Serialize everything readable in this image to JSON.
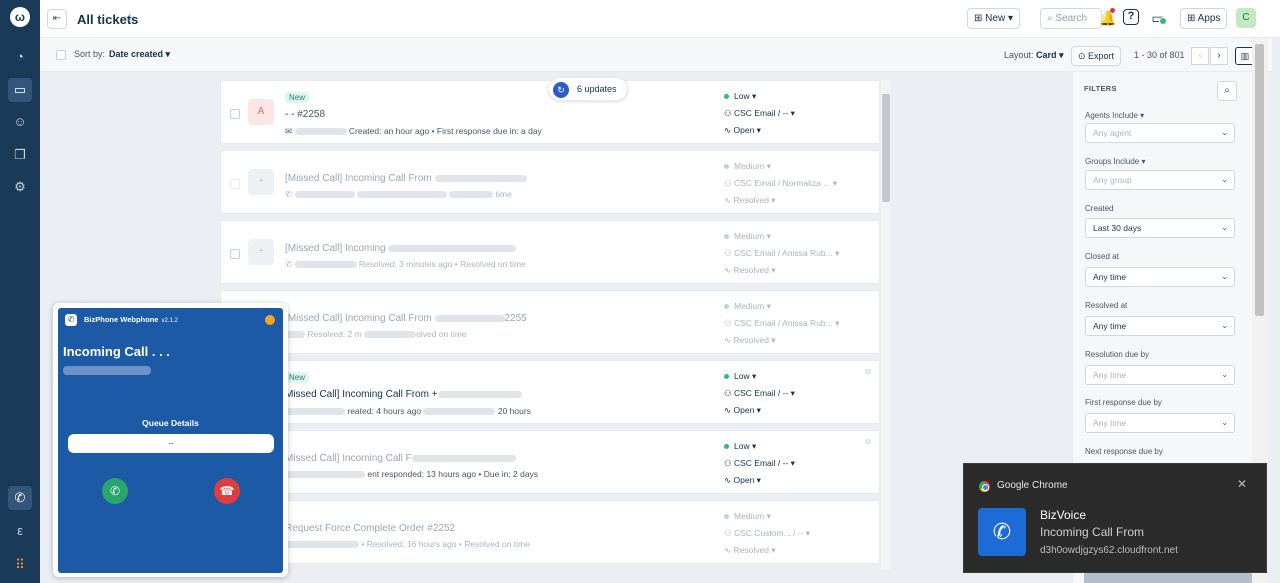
{
  "leftnav": {
    "logo": "ω",
    "items": [
      {
        "name": "dashboard-icon",
        "glyph": "◔"
      },
      {
        "name": "tickets-icon",
        "glyph": "▭"
      },
      {
        "name": "contacts-icon",
        "glyph": "☺"
      },
      {
        "name": "knowledge-base-icon",
        "glyph": "❒"
      },
      {
        "name": "admin-gear-icon",
        "glyph": "⚙"
      }
    ],
    "bottom": [
      {
        "name": "phone-channel-icon",
        "glyph": "✆"
      },
      {
        "name": "freshchat-icon",
        "glyph": "ε"
      },
      {
        "name": "apps-grid-icon",
        "glyph": "⠿"
      }
    ]
  },
  "header": {
    "title": "All tickets",
    "new_label": "New",
    "search_placeholder": "Search",
    "apps_label": "Apps",
    "avatar_initial": "C"
  },
  "toolbar": {
    "sort_label": "Sort by:",
    "sort_value": "Date created",
    "layout_label": "Layout:",
    "layout_value": "Card",
    "export_label": "Export",
    "pagination": "1 - 30 of 801"
  },
  "updates_pill": {
    "label": "6 updates"
  },
  "tickets": [
    {
      "avatar": "A",
      "badge": "New",
      "subject": "- - ",
      "id": "#2258",
      "meta": "Created: an hour ago • First response due in: a day",
      "priority": "Low",
      "group": "CSC Email / --",
      "status": "Open"
    },
    {
      "avatar": "",
      "subject": "[Missed Call] Incoming Call From",
      "meta": "time",
      "priority": "Medium",
      "group": "CSC Email / Normaliza ...",
      "status": "Resolved"
    },
    {
      "avatar": "",
      "subject": "[Missed Call] Incoming",
      "meta": "Resolved: 3 minutes ago • Resolved on time",
      "priority": "Medium",
      "group": "CSC Email / Anissa Rub...",
      "status": "Resolved"
    },
    {
      "avatar": "",
      "subject": "[Missed Call] Incoming Call From",
      "id": "2255",
      "meta": "Resolved: 2 m",
      "meta_end": "olved on time",
      "priority": "Medium",
      "group": "CSC Email / Anissa Rub...",
      "status": "Resolved"
    },
    {
      "avatar": "",
      "badge": "New",
      "subject": "Missed Call] Incoming Call From +",
      "meta": "reated: 4 hours ago",
      "meta_end": "20 hours",
      "priority": "Low",
      "group": "CSC Email / --",
      "status": "Open"
    },
    {
      "avatar": "",
      "subject": "Missed Call] Incoming Call F",
      "meta": "ent responded: 13 hours ago • Due in: 2 days",
      "priority": "Low",
      "group": "CSC Email / --",
      "status": "Open"
    },
    {
      "avatar": "",
      "subject": "Request Force Complete Order",
      "id": "#2252",
      "meta": "• Resolved: 16 hours ago • Resolved on time",
      "priority": "Medium",
      "group": "CSC Custom... / --",
      "status": "Resolved"
    }
  ],
  "filters": {
    "title": "FILTERS",
    "fields": [
      {
        "label": "Agents Include",
        "value": "Any agent",
        "placeholder": true
      },
      {
        "label": "Groups Include",
        "value": "Any group",
        "placeholder": true
      },
      {
        "label": "Created",
        "value": "Last 30 days",
        "placeholder": false
      },
      {
        "label": "Closed at",
        "value": "Any time",
        "placeholder": false
      },
      {
        "label": "Resolved at",
        "value": "Any time",
        "placeholder": false
      },
      {
        "label": "Resolution due by",
        "value": "Any time",
        "placeholder": true
      },
      {
        "label": "First response due by",
        "value": "Any time",
        "placeholder": true
      },
      {
        "label": "Next response due by",
        "value": "",
        "placeholder": true
      }
    ]
  },
  "webphone": {
    "title": "BizPhone Webphone",
    "version": "v2.1.2",
    "incoming": "Incoming Call . . .",
    "queue_label": "Queue Details",
    "queue_value": "--"
  },
  "notification": {
    "app": "Google Chrome",
    "title": "BizVoice",
    "text": "Incoming Call From",
    "url": "d3h0owdjgzys62.cloudfront.net"
  },
  "colors": {
    "nav": "#1b3a57",
    "accent": "#2c5cc5",
    "webphone": "#1d5aa6",
    "priority_dot": "#2fbf71"
  }
}
